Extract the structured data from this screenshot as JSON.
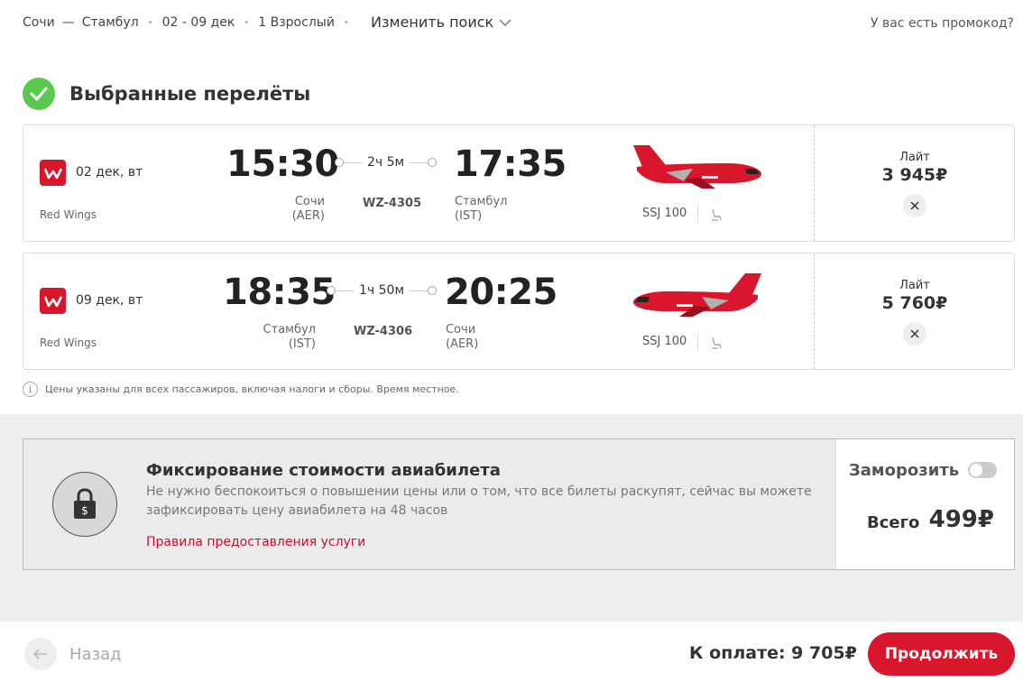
{
  "header": {
    "from": "Сочи",
    "dash": "—",
    "to": "Стамбул",
    "dot": "•",
    "dates": "02 - 09 дек",
    "passengers": "1 Взрослый",
    "change_search": "Изменить поиск",
    "promo": "У вас есть промокод?"
  },
  "selected": {
    "title": "Выбранные перелёты"
  },
  "flights": [
    {
      "date": "02 дек, вт",
      "airline": "Red Wings",
      "dep_time": "15:30",
      "arr_time": "17:35",
      "duration": "2ч 5м",
      "flight_no": "WZ-4305",
      "dep_city": "Сочи",
      "dep_code": "(AER)",
      "arr_city": "Стамбул",
      "arr_code": "(IST)",
      "aircraft": "SSJ 100",
      "fare": "Лайт",
      "price": "3 945₽"
    },
    {
      "date": "09 дек, вт",
      "airline": "Red Wings",
      "dep_time": "18:35",
      "arr_time": "20:25",
      "duration": "1ч 50м",
      "flight_no": "WZ-4306",
      "dep_city": "Стамбул",
      "dep_code": "(IST)",
      "arr_city": "Сочи",
      "arr_code": "(AER)",
      "aircraft": "SSJ 100",
      "fare": "Лайт",
      "price": "5 760₽"
    }
  ],
  "note": "Цены указаны для всех пассажиров, включая налоги и сборы. Время местное.",
  "freeze": {
    "title": "Фиксирование стоимости авиабилета",
    "description": "Не нужно беспокоиться о повышении цены или о том, что все билеты раскупят, сейчас вы можете зафиксировать цену авиабилета на 48 часов",
    "rules_link": "Правила предоставления услуги",
    "toggle_label": "Заморозить",
    "toggle_on": false,
    "total_label": "Всего",
    "total_value": "499₽"
  },
  "footer": {
    "back": "Назад",
    "to_pay": "К оплате:  9 705₽",
    "continue": "Продолжить"
  },
  "colors": {
    "brand": "#d8162c",
    "check": "#5ac84e"
  },
  "icons": [
    "chevron-down-icon",
    "check-icon",
    "airline-logo-icon",
    "airplane-icon",
    "seat-icon",
    "close-icon",
    "info-icon",
    "lock-icon",
    "arrow-left-icon"
  ]
}
